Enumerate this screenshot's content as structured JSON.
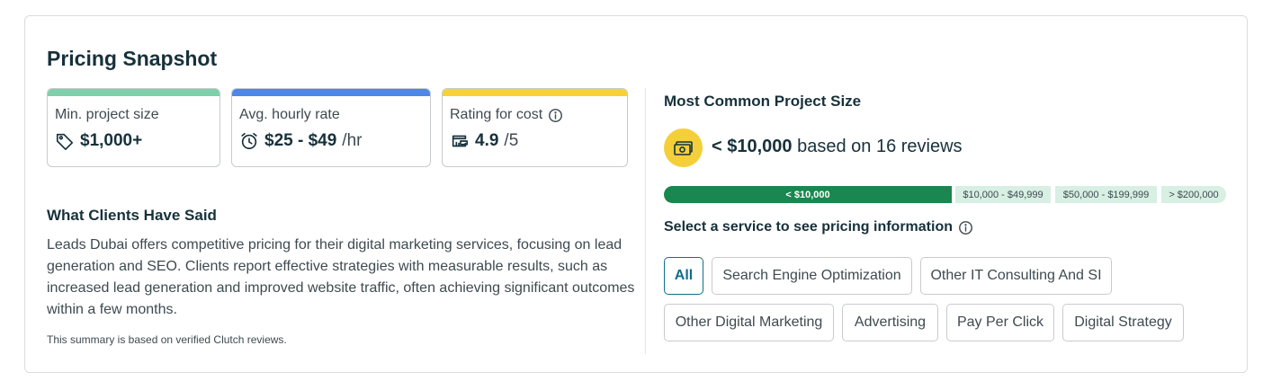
{
  "title": "Pricing Snapshot",
  "stats": [
    {
      "label": "Min. project size",
      "value": "$1,000+",
      "suffix": "",
      "color": "#7dd0aa",
      "icon": "price-tag-icon"
    },
    {
      "label": "Avg. hourly rate",
      "value": "$25 - $49",
      "suffix": "/hr",
      "color": "#4e87e4",
      "icon": "alarm-clock-icon"
    },
    {
      "label": "Rating for cost",
      "value": "4.9",
      "suffix": "/5",
      "color": "#f6d233",
      "icon": "wallet-icon"
    }
  ],
  "clients": {
    "title": "What Clients Have Said",
    "summary": "Leads Dubai offers competitive pricing for their digital marketing services, focusing on lead generation and SEO. Clients report effective strategies with measurable results, such as increased lead generation and improved website traffic, often achieving significant outcomes within a few months.",
    "footnote": "This summary is based on verified Clutch reviews."
  },
  "project_size": {
    "title": "Most Common Project Size",
    "value": "< $10,000",
    "based_on": "based on 16 reviews",
    "segments": [
      "< $10,000",
      "$10,000 - $49,999",
      "$50,000 - $199,999",
      "> $200,000"
    ],
    "segment_shares": [
      0.51,
      0.17,
      0.18,
      0.12
    ],
    "accent": "#19874f",
    "muted": "#d8efe3"
  },
  "services": {
    "prompt": "Select a service to see pricing information",
    "chips": [
      "All",
      "Search Engine Optimization",
      "Other IT Consulting And SI",
      "Other Digital Marketing",
      "Advertising",
      "Pay Per Click",
      "Digital Strategy"
    ],
    "selected": "All"
  }
}
